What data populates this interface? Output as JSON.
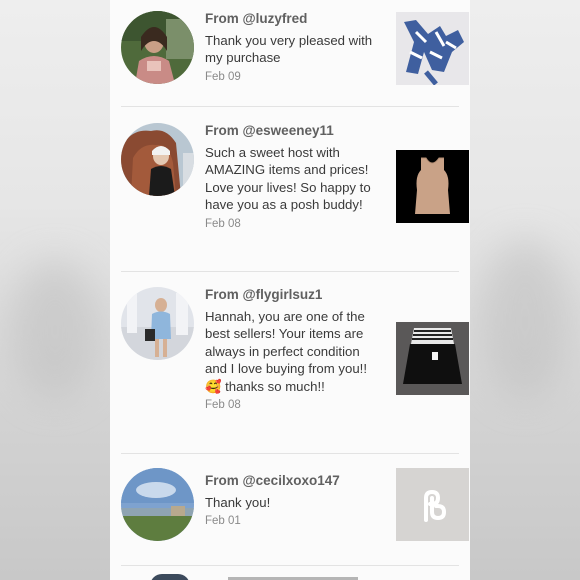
{
  "feed": [
    {
      "from": "From @luzyfred",
      "message": "Thank you very pleased with my purchase",
      "date": "Feb 09",
      "item_icon": "swimsuit-photo"
    },
    {
      "from": "From @esweeney11",
      "message": "Such a sweet host with AMAZING items and prices! Love your lives! So happy to have you as a posh buddy!",
      "date": "Feb 08",
      "item_icon": "tank-top-photo"
    },
    {
      "from": "From @flygirlsuz1",
      "message": "Hannah, you are one of the best sellers! Your items are always in perfect condition and I love buying from you!! 🥰 thanks so much!!",
      "date": "Feb 08",
      "item_icon": "dress-photo"
    },
    {
      "from": "From @cecilxoxo147",
      "message": "Thank you!",
      "date": "Feb 01",
      "item_icon": "placeholder-logo-icon"
    }
  ]
}
